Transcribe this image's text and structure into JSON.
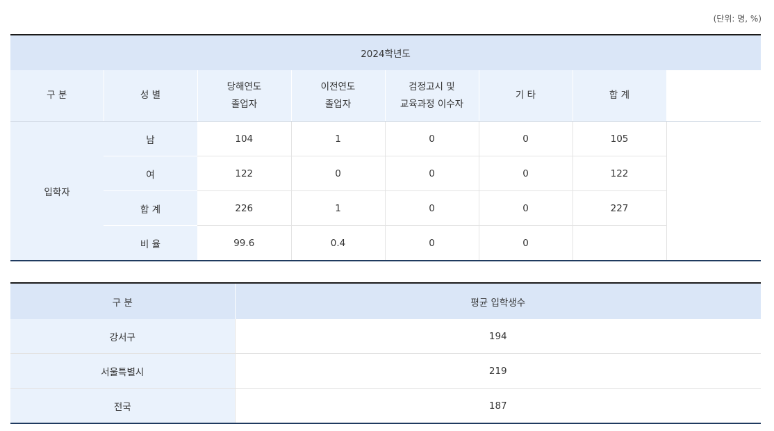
{
  "unit_note": "(단위: 명, %)",
  "table1": {
    "year_header": "2024학년도",
    "headers": [
      "구 분",
      "성 별",
      "당해연도\n졸업자",
      "이전연도\n졸업자",
      "검정고시 및\n교육과정 이수자",
      "기 타",
      "합 계"
    ],
    "group_label": "입학자",
    "rows": [
      {
        "label": "남",
        "values": [
          "104",
          "1",
          "0",
          "0",
          "105"
        ]
      },
      {
        "label": "여",
        "values": [
          "122",
          "0",
          "0",
          "0",
          "122"
        ]
      },
      {
        "label": "합 계",
        "values": [
          "226",
          "1",
          "0",
          "0",
          "227"
        ]
      },
      {
        "label": "비 율",
        "values": [
          "99.6",
          "0.4",
          "0",
          "0",
          ""
        ]
      }
    ]
  },
  "table2": {
    "headers": [
      "구 분",
      "평균 입학생수"
    ],
    "rows": [
      {
        "label": "강서구",
        "value": "194"
      },
      {
        "label": "서울특별시",
        "value": "219"
      },
      {
        "label": "전국",
        "value": "187"
      }
    ]
  }
}
